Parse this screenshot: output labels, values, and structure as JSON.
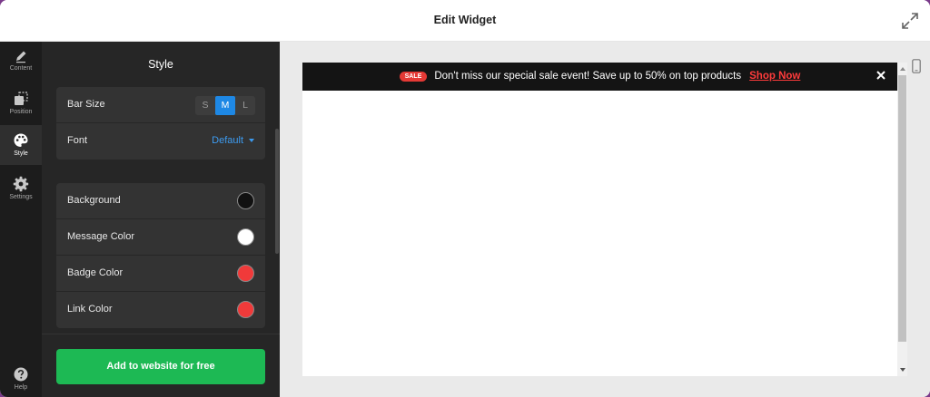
{
  "window": {
    "title": "Edit Widget"
  },
  "iconbar": {
    "items": [
      {
        "label": "Content",
        "icon": "pencil-icon",
        "active": false
      },
      {
        "label": "Position",
        "icon": "position-icon",
        "active": false
      },
      {
        "label": "Style",
        "icon": "palette-icon",
        "active": true
      },
      {
        "label": "Settings",
        "icon": "gear-icon",
        "active": false
      }
    ],
    "help": {
      "label": "Help",
      "icon": "help-icon"
    }
  },
  "panel": {
    "title": "Style",
    "bar_size": {
      "label": "Bar Size",
      "options": [
        "S",
        "M",
        "L"
      ],
      "selected": "M"
    },
    "font": {
      "label": "Font",
      "value": "Default"
    },
    "colors": [
      {
        "label": "Background",
        "color": "#111111"
      },
      {
        "label": "Message Color",
        "color": "#ffffff"
      },
      {
        "label": "Badge Color",
        "color": "#f03a3a"
      },
      {
        "label": "Link Color",
        "color": "#f03a3a"
      }
    ],
    "cta_label": "Add to website for free"
  },
  "preview": {
    "banner": {
      "badge": "SALE",
      "message": "Don't miss our special sale event! Save up to 50% on top products",
      "link": "Shop Now",
      "close_icon": "close-icon"
    },
    "device_icon": "mobile-icon"
  },
  "colors": {
    "accent": "#1e88e5",
    "cta": "#1db954",
    "panel_bg": "#262626",
    "banner_bg": "#141414",
    "badge": "#e53935",
    "link": "#ff3b3b"
  }
}
